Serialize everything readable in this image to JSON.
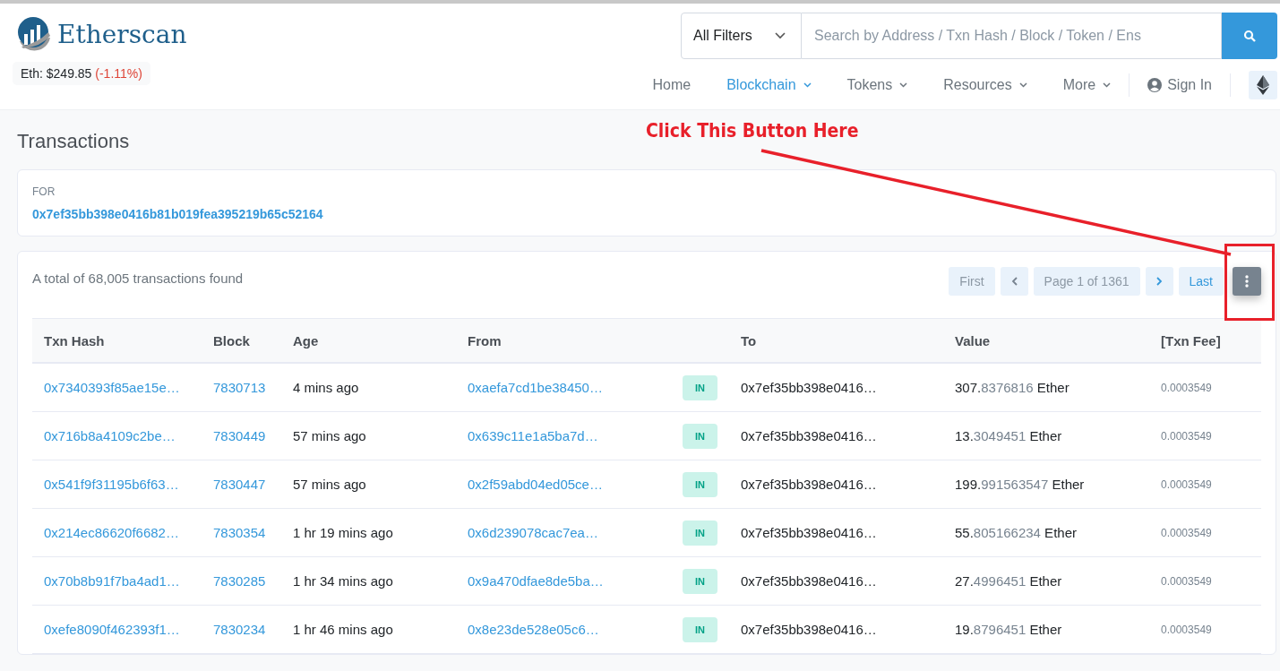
{
  "header": {
    "logo_text": "Etherscan",
    "price": {
      "label": "Eth: $249.85",
      "change": "(-1.11%)"
    },
    "search": {
      "filter": "All Filters",
      "placeholder": "Search by Address / Txn Hash / Block / Token / Ens"
    },
    "nav": [
      {
        "label": "Home",
        "selected": false,
        "dropdown": false
      },
      {
        "label": "Blockchain",
        "selected": true,
        "dropdown": true
      },
      {
        "label": "Tokens",
        "selected": false,
        "dropdown": true
      },
      {
        "label": "Resources",
        "selected": false,
        "dropdown": true
      },
      {
        "label": "More",
        "selected": false,
        "dropdown": true
      }
    ],
    "sign_in": "Sign In"
  },
  "page_title": "Transactions",
  "for_card": {
    "label": "FOR",
    "address": "0x7ef35bb398e0416b81b019fea395219b65c52164"
  },
  "summary": "A total of 68,005 transactions found",
  "pagination": {
    "first": "First",
    "page": "Page 1 of 1361",
    "last": "Last"
  },
  "annotation": {
    "text": "Click This Button Here"
  },
  "table": {
    "columns": [
      "Txn Hash",
      "Block",
      "Age",
      "From",
      "",
      "To",
      "Value",
      "[Txn Fee]"
    ],
    "rows": [
      {
        "hash": "0x7340393f85ae15e…",
        "block": "7830713",
        "age": "4 mins ago",
        "from": "0xaefa7cd1be38450…",
        "direction": "IN",
        "to": "0x7ef35bb398e0416…",
        "value_whole": "307.",
        "value_fraction": "8376816",
        "unit": "Ether",
        "fee": "0.0003549"
      },
      {
        "hash": "0x716b8a4109c2be…",
        "block": "7830449",
        "age": "57 mins ago",
        "from": "0x639c11e1a5ba7d…",
        "direction": "IN",
        "to": "0x7ef35bb398e0416…",
        "value_whole": "13.",
        "value_fraction": "3049451",
        "unit": "Ether",
        "fee": "0.0003549"
      },
      {
        "hash": "0x541f9f31195b6f63…",
        "block": "7830447",
        "age": "57 mins ago",
        "from": "0x2f59abd04ed05ce…",
        "direction": "IN",
        "to": "0x7ef35bb398e0416…",
        "value_whole": "199.",
        "value_fraction": "991563547",
        "unit": "Ether",
        "fee": "0.0003549"
      },
      {
        "hash": "0x214ec86620f6682…",
        "block": "7830354",
        "age": "1 hr 19 mins ago",
        "from": "0x6d239078cac7ea…",
        "direction": "IN",
        "to": "0x7ef35bb398e0416…",
        "value_whole": "55.",
        "value_fraction": "805166234",
        "unit": "Ether",
        "fee": "0.0003549"
      },
      {
        "hash": "0x70b8b91f7ba4ad1…",
        "block": "7830285",
        "age": "1 hr 34 mins ago",
        "from": "0x9a470dfae8de5ba…",
        "direction": "IN",
        "to": "0x7ef35bb398e0416…",
        "value_whole": "27.",
        "value_fraction": "4996451",
        "unit": "Ether",
        "fee": "0.0003549"
      },
      {
        "hash": "0xefe8090f462393f1…",
        "block": "7830234",
        "age": "1 hr 46 mins ago",
        "from": "0x8e23de528e05c6…",
        "direction": "IN",
        "to": "0x7ef35bb398e0416…",
        "value_whole": "19.",
        "value_fraction": "8796451",
        "unit": "Ether",
        "fee": "0.0003549"
      }
    ]
  }
}
